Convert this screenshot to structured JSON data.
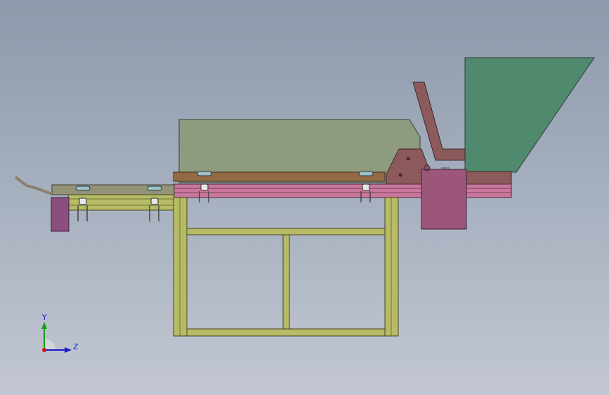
{
  "viewport": {
    "colors": {
      "background_top": "#8c9aab",
      "background_bottom": "#c2c7d2",
      "hopper": "#4f8a6e",
      "cover": "#8f9b7f",
      "frame": "#b7bb66",
      "rail": "#c9779d",
      "gearbox": "#9b5679",
      "bracket": "#8c5a5a",
      "belt": "#946a44"
    }
  },
  "triad": {
    "y_label": "Y",
    "z_label": "Z"
  }
}
